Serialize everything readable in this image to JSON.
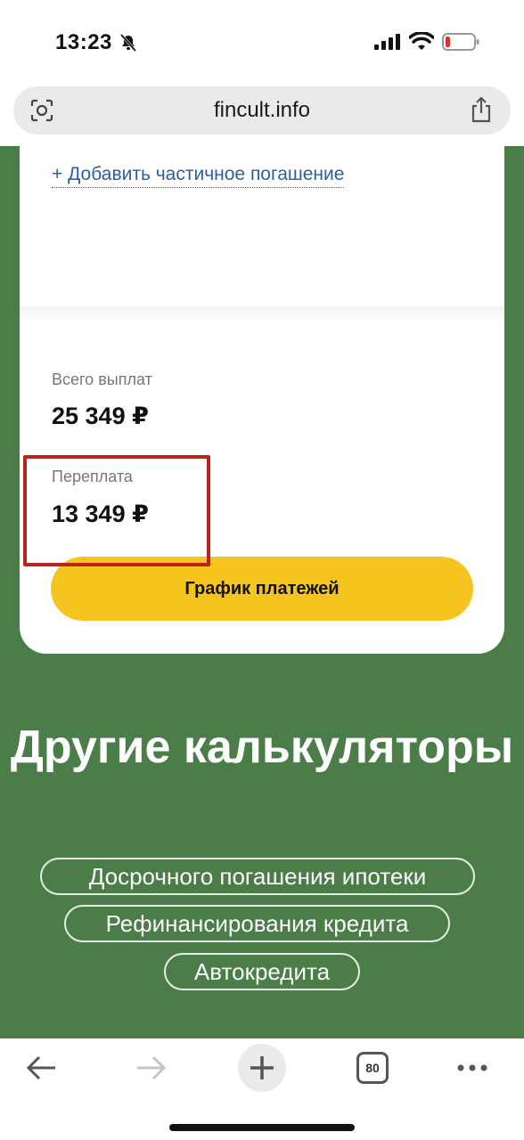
{
  "status_bar": {
    "time": "13:23",
    "icons": [
      "bell-slash-icon",
      "signal-icon",
      "wifi-icon",
      "battery-low-icon"
    ]
  },
  "browser": {
    "url": "fincult.info",
    "icons": {
      "left": "camera-search-icon",
      "right": "share-icon"
    }
  },
  "card": {
    "add_partial_link": "+ Добавить частичное погашение",
    "total_label": "Всего выплат",
    "total_value": "25 349 ₽",
    "overpay_label": "Переплата",
    "overpay_value": "13 349 ₽",
    "schedule_button": "График платежей"
  },
  "other": {
    "title": "Другие калькуляторы",
    "links": [
      "Досрочного погашения ипотеки",
      "Рефинансирования кредита",
      "Автокредита"
    ]
  },
  "toolbar": {
    "tabs_count": "80",
    "icons": [
      "back-arrow-icon",
      "forward-arrow-icon",
      "plus-icon",
      "tabs-icon",
      "more-icon"
    ]
  },
  "colors": {
    "green_bg": "#4a7d48",
    "button_yellow": "#f7c41f",
    "highlight_red": "#b8231a",
    "link_blue": "#2a5fa8"
  }
}
